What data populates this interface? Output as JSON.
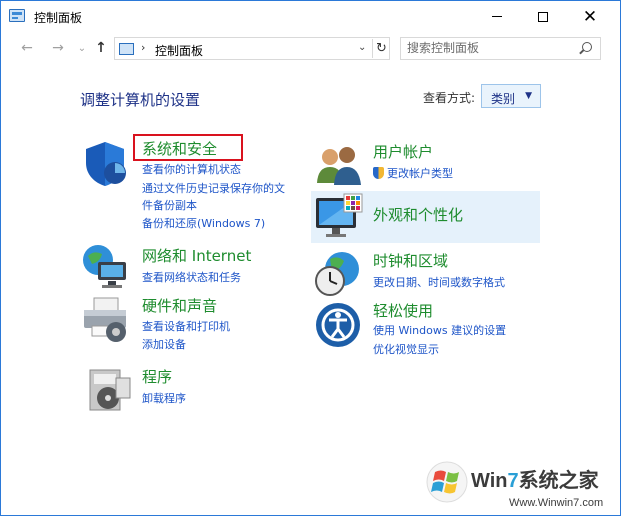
{
  "window": {
    "title": "控制面板",
    "min_label": "",
    "max_label": "",
    "close_label": "✕"
  },
  "nav": {
    "back": "←",
    "forward": "→",
    "recent": "⌄",
    "up": "↑",
    "address_sep": "›",
    "address_text": "控制面板",
    "address_dropdown": "⌄",
    "refresh": "↻",
    "search_placeholder": "搜索控制面板"
  },
  "content": {
    "heading": "调整计算机的设置",
    "view_by_label": "查看方式:",
    "view_by_value": "类别",
    "view_by_caret": "▼"
  },
  "categories": [
    {
      "id": "system-security",
      "title": "系统和安全",
      "icon": "shield-icon",
      "links": [
        "查看你的计算机状态",
        "通过文件历史记录保存你的文",
        "件备份副本",
        "备份和还原(Windows 7)"
      ]
    },
    {
      "id": "network",
      "title": "网络和 Internet",
      "icon": "network-globe-icon",
      "links": [
        "查看网络状态和任务"
      ]
    },
    {
      "id": "hardware-sound",
      "title": "硬件和声音",
      "icon": "printer-icon",
      "links": [
        "查看设备和打印机",
        "添加设备"
      ]
    },
    {
      "id": "programs",
      "title": "程序",
      "icon": "programs-disc-icon",
      "links": [
        "卸载程序"
      ]
    },
    {
      "id": "user-accounts",
      "title": "用户帐户",
      "icon": "users-icon",
      "links": [
        "更改帐户类型"
      ]
    },
    {
      "id": "appearance",
      "title": "外观和个性化",
      "icon": "monitor-palette-icon",
      "links": []
    },
    {
      "id": "clock-region",
      "title": "时钟和区域",
      "icon": "clock-globe-icon",
      "links": [
        "更改日期、时间或数字格式"
      ]
    },
    {
      "id": "ease-of-access",
      "title": "轻松使用",
      "icon": "ease-of-access-icon",
      "links": [
        "使用 Windows 建议的设置",
        "优化视觉显示"
      ]
    }
  ],
  "watermark": {
    "brand_a": "Win",
    "brand_b": "7",
    "brand_c": "系统之家",
    "url": "Www.Winwin7.com"
  },
  "colors": {
    "category_title": "#1e8c2e",
    "link": "#1e55c8",
    "heading": "#1e3287",
    "highlight": "#d9121e",
    "hover": "#e5f1fb"
  }
}
